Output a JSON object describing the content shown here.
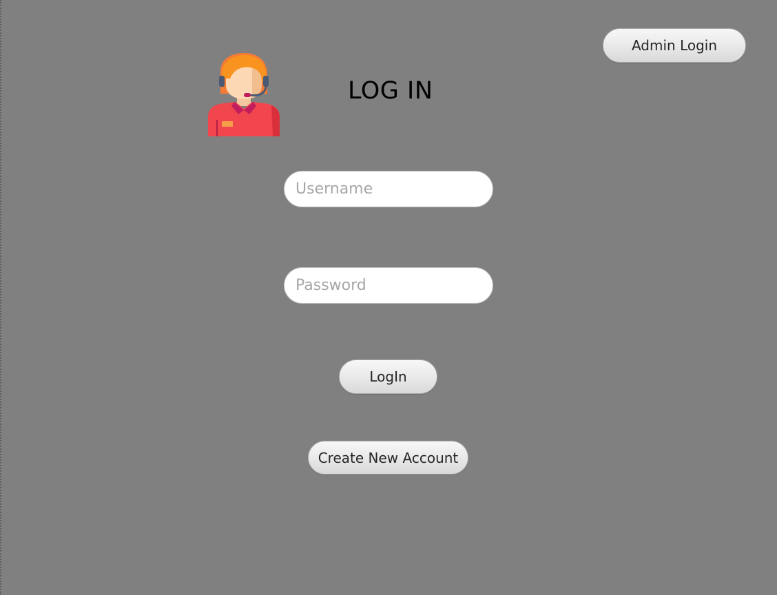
{
  "header": {
    "admin_login_label": "Admin Login"
  },
  "form": {
    "title": "LOG IN",
    "username_placeholder": "Username",
    "password_placeholder": "Password",
    "login_label": "LogIn",
    "create_account_label": "Create New Account"
  },
  "icons": {
    "avatar": "support-agent-icon"
  },
  "colors": {
    "background": "#808080",
    "avatar_hair": "#F7931E",
    "avatar_shirt": "#F2464E"
  }
}
